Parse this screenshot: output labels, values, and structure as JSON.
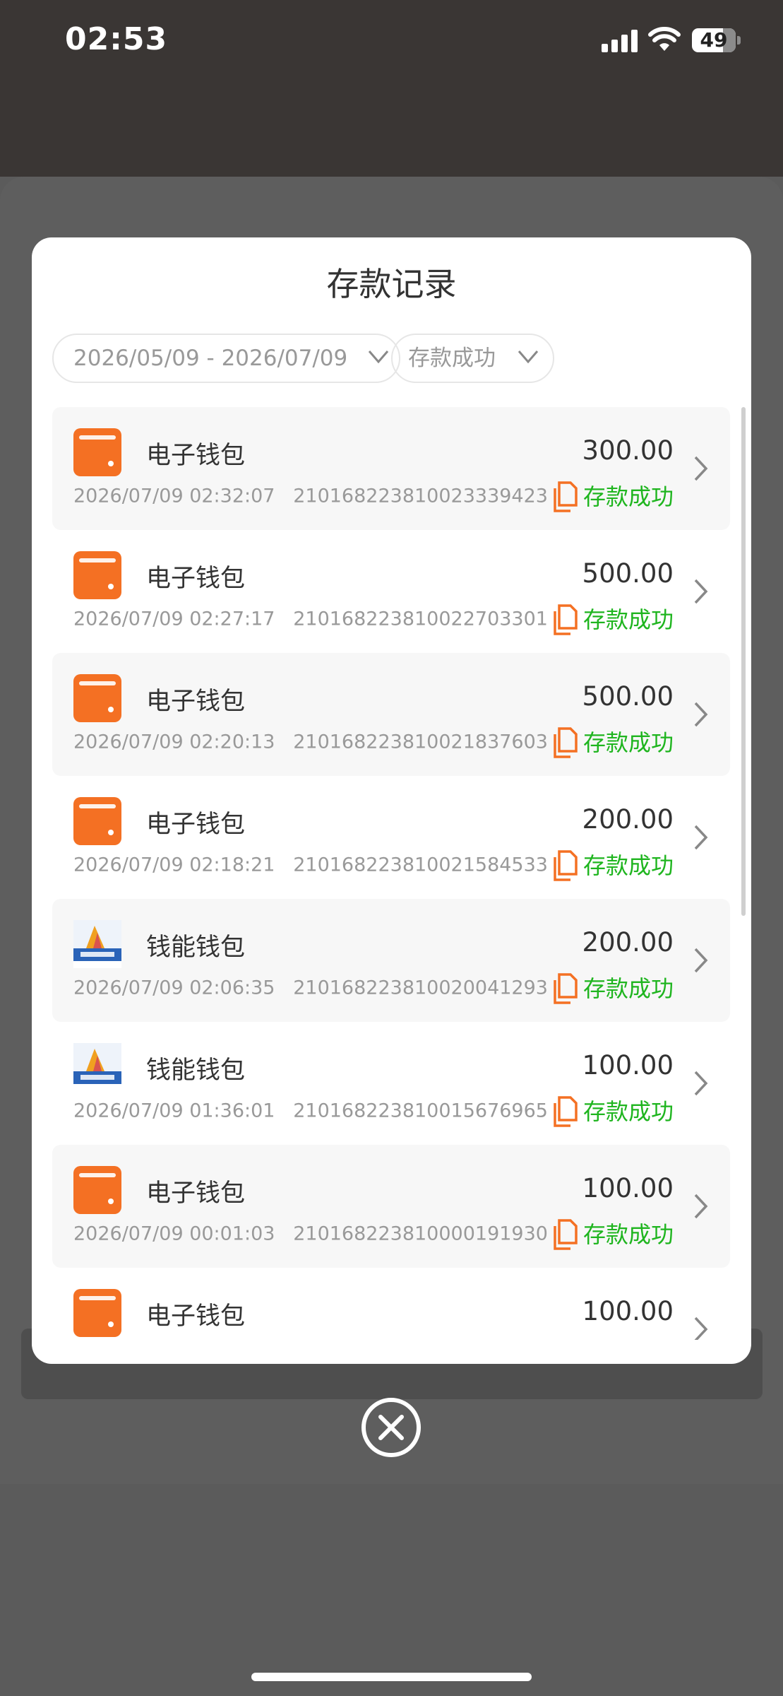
{
  "status_bar": {
    "time": "02:53",
    "battery": "49"
  },
  "modal": {
    "title": "存款记录",
    "date_range": "2026/05/09 - 2026/07/09",
    "status_filter": "存款成功"
  },
  "records": [
    {
      "name": "电子钱包",
      "icon": "wallet-icon",
      "datetime": "2026/07/09 02:32:07",
      "order_no": "210168223810023339423",
      "amount": "300.00",
      "status": "存款成功"
    },
    {
      "name": "电子钱包",
      "icon": "wallet-icon",
      "datetime": "2026/07/09 02:27:17",
      "order_no": "210168223810022703301",
      "amount": "500.00",
      "status": "存款成功"
    },
    {
      "name": "电子钱包",
      "icon": "wallet-icon",
      "datetime": "2026/07/09 02:20:13",
      "order_no": "210168223810021837603",
      "amount": "500.00",
      "status": "存款成功"
    },
    {
      "name": "电子钱包",
      "icon": "wallet-icon",
      "datetime": "2026/07/09 02:18:21",
      "order_no": "210168223810021584533",
      "amount": "200.00",
      "status": "存款成功"
    },
    {
      "name": "钱能钱包",
      "icon": "qianneng-logo-icon",
      "datetime": "2026/07/09 02:06:35",
      "order_no": "210168223810020041293",
      "amount": "200.00",
      "status": "存款成功"
    },
    {
      "name": "钱能钱包",
      "icon": "qianneng-logo-icon",
      "datetime": "2026/07/09 01:36:01",
      "order_no": "210168223810015676965",
      "amount": "100.00",
      "status": "存款成功"
    },
    {
      "name": "电子钱包",
      "icon": "wallet-icon",
      "datetime": "2026/07/09 00:01:03",
      "order_no": "210168223810000191930",
      "amount": "100.00",
      "status": "存款成功"
    },
    {
      "name": "电子钱包",
      "icon": "wallet-icon",
      "datetime": "",
      "order_no": "",
      "amount": "100.00",
      "status": ""
    }
  ],
  "colors": {
    "accent": "#f47023",
    "success": "#1fb51f"
  }
}
